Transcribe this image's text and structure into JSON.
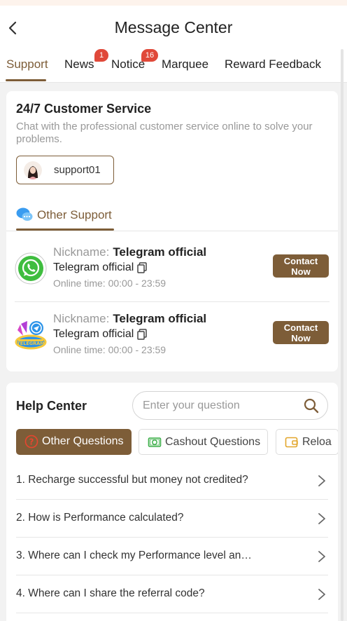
{
  "header": {
    "title": "Message Center"
  },
  "tabs": [
    {
      "label": "Support",
      "badge": ""
    },
    {
      "label": "News",
      "badge": "1"
    },
    {
      "label": "Notice",
      "badge": "16"
    },
    {
      "label": "Marquee",
      "badge": ""
    },
    {
      "label": "Reward Feedback",
      "badge": ""
    }
  ],
  "customer_service": {
    "title": "24/7 Customer Service",
    "description": "Chat with the professional customer service online to solve your problems.",
    "agent_name": "support01"
  },
  "other_support": {
    "label": "Other Support",
    "contacts": [
      {
        "nickname_label": "Nickname:",
        "nickname": "Telegram official",
        "name": "Telegram official",
        "online_time": "Online time: 00:00 - 23:59",
        "button_line1": "Contact",
        "button_line2": "Now",
        "icon": "whatsapp-icon"
      },
      {
        "nickname_label": "Nickname:",
        "nickname": "Telegram official",
        "name": "Telegram official",
        "online_time": "Online time: 00:00 - 23:59",
        "button_line1": "Contact",
        "button_line2": "Now",
        "icon": "telegram-badge-icon"
      }
    ]
  },
  "help_center": {
    "title": "Help Center",
    "search_placeholder": "Enter your question",
    "categories": [
      {
        "label": "Other Questions",
        "active": true,
        "icon": "question-circle-icon"
      },
      {
        "label": "Cashout Questions",
        "active": false,
        "icon": "cash-icon"
      },
      {
        "label": "Reloa",
        "active": false,
        "icon": "wallet-icon"
      }
    ],
    "questions": [
      "1. Recharge successful but money not credited?",
      "2. How is Performance calculated?",
      "3. Where can I check my Performance level an…",
      "4. Where can I share the referral code?"
    ]
  },
  "colors": {
    "accent": "#7d5d38",
    "badge": "#e0493a",
    "whatsapp": "#3fbd3f"
  }
}
